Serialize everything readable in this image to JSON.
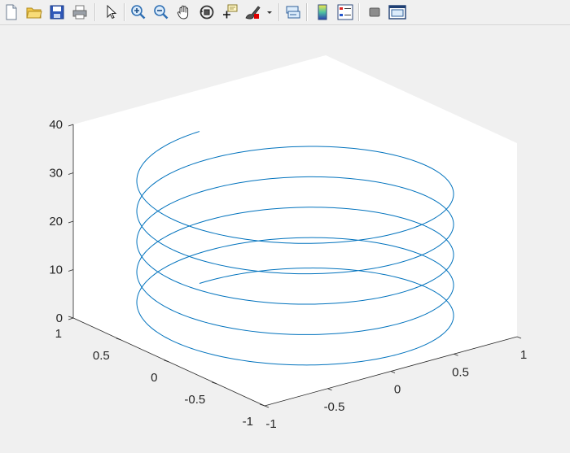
{
  "toolbar": {
    "buttons": [
      {
        "id": "new-figure",
        "icon": "new-document-icon"
      },
      {
        "id": "open-file",
        "icon": "folder-open-icon"
      },
      {
        "id": "save-figure",
        "icon": "floppy-disk-icon"
      },
      {
        "id": "print-figure",
        "icon": "printer-icon"
      },
      {
        "id": "edit-plot",
        "icon": "arrow-cursor-icon"
      },
      {
        "id": "zoom-in",
        "icon": "zoom-in-icon"
      },
      {
        "id": "zoom-out",
        "icon": "zoom-out-icon"
      },
      {
        "id": "pan",
        "icon": "hand-icon"
      },
      {
        "id": "rotate-3d",
        "icon": "rotate-3d-icon"
      },
      {
        "id": "data-cursor",
        "icon": "data-cursor-icon"
      },
      {
        "id": "brush",
        "icon": "brush-icon"
      },
      {
        "id": "link-plot",
        "icon": "link-plot-icon"
      },
      {
        "id": "insert-colorbar",
        "icon": "colorbar-icon"
      },
      {
        "id": "insert-legend",
        "icon": "legend-icon"
      },
      {
        "id": "hide-plot-tools",
        "icon": "hide-tools-icon"
      },
      {
        "id": "show-plot-tools",
        "icon": "show-tools-icon"
      }
    ]
  },
  "colors": {
    "line": "#0072bd",
    "axes_text": "#262626",
    "axes_bg": "#ffffff",
    "figure_bg": "#f0f0f0"
  },
  "chart_data": {
    "type": "line",
    "title": "",
    "xlabel": "",
    "ylabel": "",
    "zlabel": "",
    "xlim": [
      -1,
      1
    ],
    "ylim": [
      -1,
      1
    ],
    "zlim": [
      0,
      40
    ],
    "x_ticks": [
      "-1",
      "-0.5",
      "0",
      "0.5",
      "1"
    ],
    "y_ticks": [
      "-1",
      "-0.5",
      "0",
      "0.5",
      "1"
    ],
    "z_ticks": [
      "0",
      "10",
      "20",
      "30",
      "40"
    ],
    "grid": false,
    "view": "3d",
    "series": [
      {
        "x": "sin(t)",
        "y": "cos(t)",
        "z": "t",
        "t_range": [
          0,
          31.4159
        ]
      }
    ]
  }
}
